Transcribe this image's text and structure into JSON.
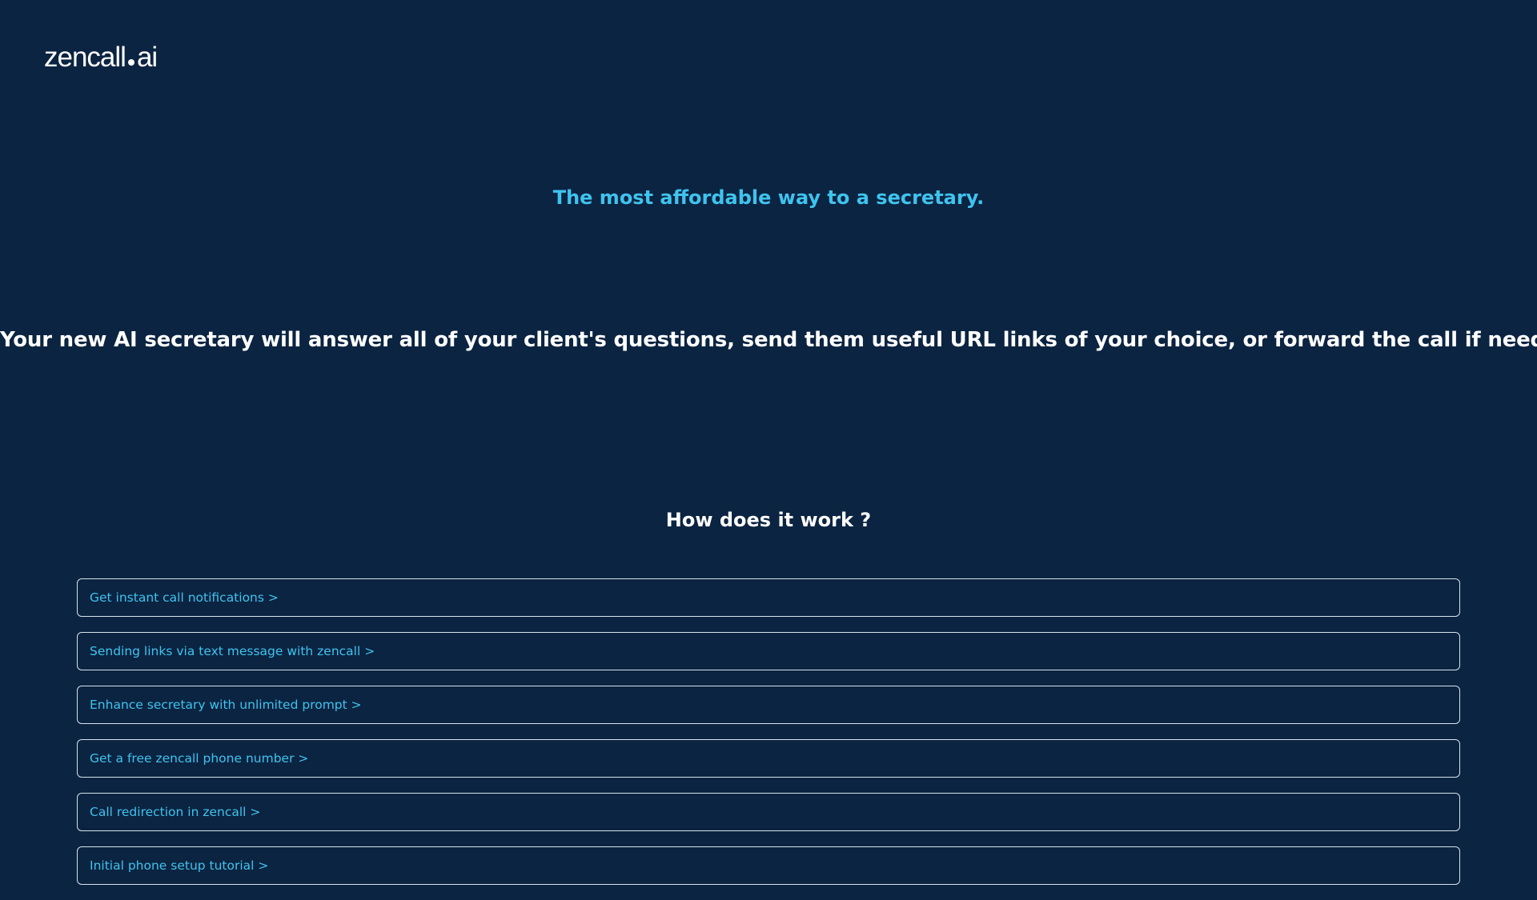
{
  "brand": {
    "logo_left": "zencall",
    "logo_right": "ai"
  },
  "hero": {
    "tagline": "The most affordable way to a secretary.",
    "intro": "Your new AI secretary will answer all of your client's questions, send them useful URL links of your choice, or forward the call if needed."
  },
  "how": {
    "heading": "How does it work ?",
    "items": [
      {
        "label": "Get instant call notifications >"
      },
      {
        "label": "Sending links via text message with zencall >"
      },
      {
        "label": "Enhance secretary with unlimited prompt >"
      },
      {
        "label": "Get a free zencall phone number >"
      },
      {
        "label": "Call redirection in zencall >"
      },
      {
        "label": "Initial phone setup tutorial >"
      }
    ]
  },
  "colors": {
    "background": "#0b2441",
    "accent": "#3fc3ef",
    "text": "#ffffff",
    "border": "#d7e3ee"
  }
}
